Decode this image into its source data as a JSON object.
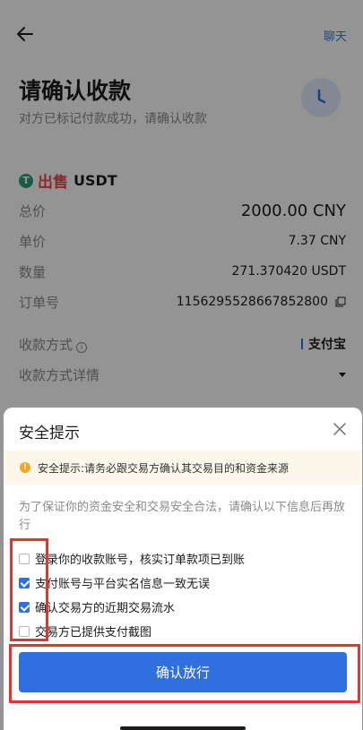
{
  "header": {
    "chat_label": "聊天"
  },
  "page": {
    "title": "请确认收款",
    "subtitle": "对方已标记付款成功，请确认收款"
  },
  "order": {
    "side": "出售",
    "asset": "USDT",
    "rows": [
      {
        "key": "总价",
        "value": "2000.00 CNY"
      },
      {
        "key": "单价",
        "value": "7.37 CNY"
      },
      {
        "key": "数量",
        "value": "271.370420 USDT"
      },
      {
        "key": "订单号",
        "value": "1156295528667852800"
      }
    ],
    "payment_method_label": "收款方式",
    "payment_method_value": "支付宝",
    "payment_details_label": "收款方式详情"
  },
  "sheet": {
    "title": "安全提示",
    "warning": "安全提示:请务必跟交易方确认其交易目的和资金来源",
    "notice": "为了保证你的资金安全和交易安全合法，请确认以下信息后再放行",
    "checks": [
      {
        "label": "登录你的收款账号，核实订单款项已到账",
        "checked": false
      },
      {
        "label": "支付账号与平台实名信息一致无误",
        "checked": true
      },
      {
        "label": "确认交易方的近期交易流水",
        "checked": true
      },
      {
        "label": "交易方已提供支付截图",
        "checked": false
      }
    ],
    "confirm_label": "确认放行"
  },
  "colors": {
    "accent": "#2f6fdf",
    "sell": "#e84a4a",
    "annotation": "#e8322f"
  }
}
